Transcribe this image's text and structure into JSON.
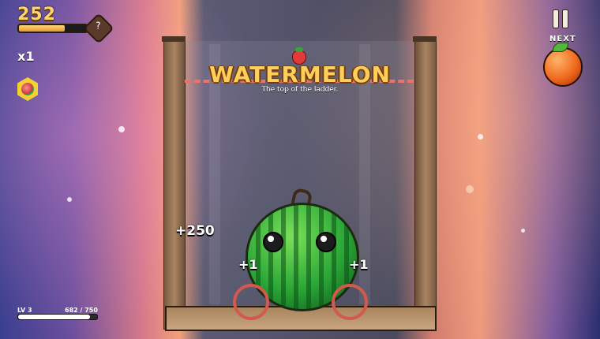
{
  "hud": {
    "score": "252",
    "score_progress": 0.68,
    "help_label": "?",
    "multiplier": "x1",
    "level_label": "LV 3",
    "xp_label": "682 / 750",
    "xp_progress": 0.909,
    "next_label": "NEXT",
    "next_fruit": "orange"
  },
  "board": {
    "title": "WATERMELON",
    "subtitle": "The top of the ladder.",
    "current_fruit": "watermelon",
    "icon_above_title": "strawberry-icon"
  },
  "popups": {
    "big": "+250",
    "left": "+1",
    "right": "+1"
  },
  "colors": {
    "title": "#ffcf5e",
    "danger_line": "#e9726b",
    "ring": "#d4594d"
  }
}
